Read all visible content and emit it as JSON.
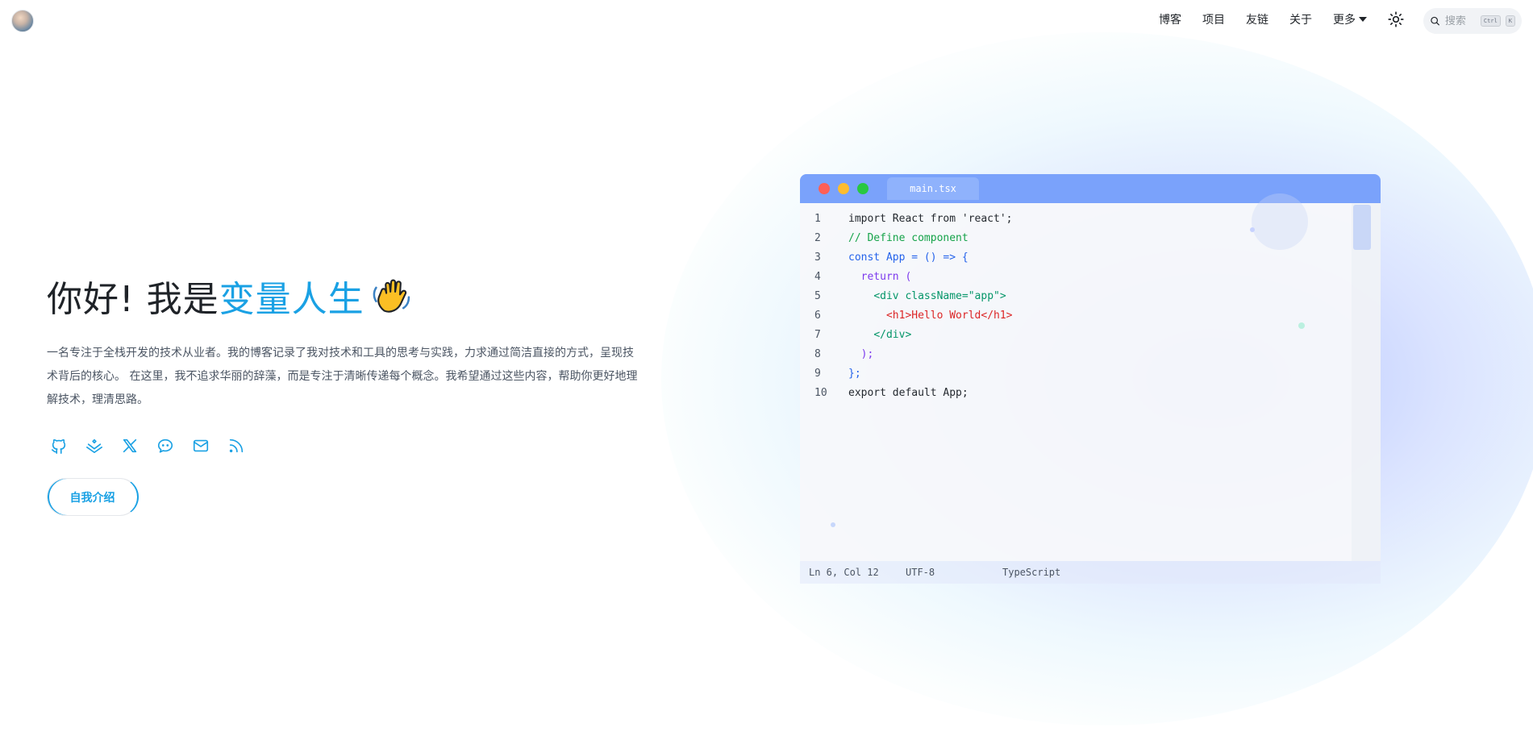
{
  "header": {
    "nav": [
      {
        "label": "博客"
      },
      {
        "label": "项目"
      },
      {
        "label": "友链"
      },
      {
        "label": "关于"
      }
    ],
    "more_label": "更多",
    "search": {
      "placeholder": "搜索",
      "kbd_modifier": "Ctrl",
      "kbd_key": "K"
    }
  },
  "hero": {
    "greeting": "你好! 我是",
    "name": "变量人生",
    "description": "一名专注于全栈开发的技术从业者。我的博客记录了我对技术和工具的思考与实践，力求通过简洁直接的方式，呈现技术背后的核心。 在这里，我不追求华丽的辞藻，而是专注于清晰传递每个概念。我希望通过这些内容，帮助你更好地理解技术，理清思路。",
    "social_icons": [
      "github-icon",
      "juejin-icon",
      "x-icon",
      "wechat-icon",
      "mail-icon",
      "rss-icon"
    ],
    "intro_button": "自我介绍"
  },
  "editor": {
    "filename": "main.tsx",
    "lines": [
      {
        "n": "1",
        "indent": "",
        "tokens": [
          {
            "t": "import React from 'react';",
            "c": "plain"
          }
        ]
      },
      {
        "n": "2",
        "indent": "",
        "tokens": [
          {
            "t": "// Define component",
            "c": "comment"
          }
        ]
      },
      {
        "n": "3",
        "indent": "",
        "tokens": [
          {
            "t": "const App = () => {",
            "c": "blue"
          }
        ]
      },
      {
        "n": "4",
        "indent": "  ",
        "tokens": [
          {
            "t": "return (",
            "c": "purple"
          }
        ]
      },
      {
        "n": "5",
        "indent": "    ",
        "tokens": [
          {
            "t": "<div className=\"app\">",
            "c": "green"
          }
        ]
      },
      {
        "n": "6",
        "indent": "      ",
        "tokens": [
          {
            "t": "<h1>Hello World</h1>",
            "c": "red"
          }
        ]
      },
      {
        "n": "7",
        "indent": "    ",
        "tokens": [
          {
            "t": "</div>",
            "c": "green"
          }
        ]
      },
      {
        "n": "8",
        "indent": "  ",
        "tokens": [
          {
            "t": ");",
            "c": "purple"
          }
        ]
      },
      {
        "n": "9",
        "indent": "",
        "tokens": [
          {
            "t": "};",
            "c": "blue"
          }
        ]
      },
      {
        "n": "10",
        "indent": "",
        "tokens": [
          {
            "t": "export default App;",
            "c": "plain"
          }
        ]
      }
    ],
    "status": {
      "position": "Ln 6, Col 12",
      "encoding": "UTF-8",
      "language": "TypeScript"
    }
  },
  "colors": {
    "accent": "#1aa1e4",
    "titlebar": "#7aa2fb"
  }
}
